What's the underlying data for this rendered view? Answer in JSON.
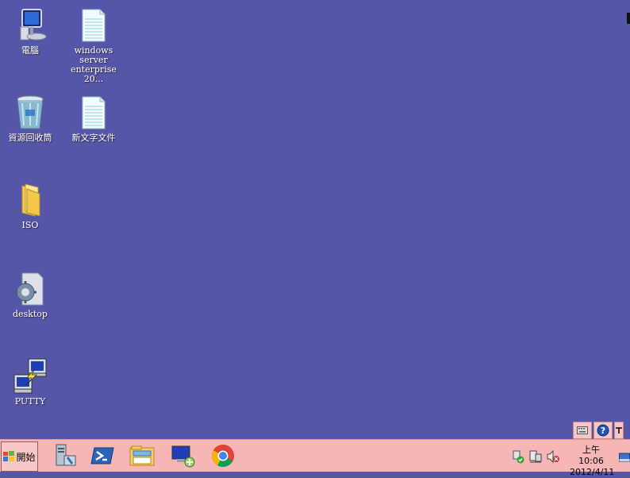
{
  "desktop": {
    "icons": [
      {
        "label": "電腦"
      },
      {
        "label": "windows server enterprise  20..."
      },
      {
        "label": "資源回收筒"
      },
      {
        "label": "新文字文件"
      },
      {
        "label": "ISO"
      },
      {
        "label": "desktop"
      },
      {
        "label": "PUTTY"
      }
    ],
    "background_color": "#5656a8"
  },
  "help_bar": {
    "items": [
      "keyboard-icon",
      "help-icon"
    ]
  },
  "taskbar": {
    "start_label": "開始",
    "pinned_apps": [
      "server-manager-icon",
      "powershell-icon",
      "explorer-icon",
      "remote-desktop-icon",
      "chrome-icon"
    ],
    "tray": {
      "icons": [
        "action-center-icon",
        "network-icon",
        "volume-muted-icon"
      ],
      "clock_time": "上午 10:06",
      "clock_date": "2012/4/11"
    },
    "background_color": "#f6b6b6"
  }
}
